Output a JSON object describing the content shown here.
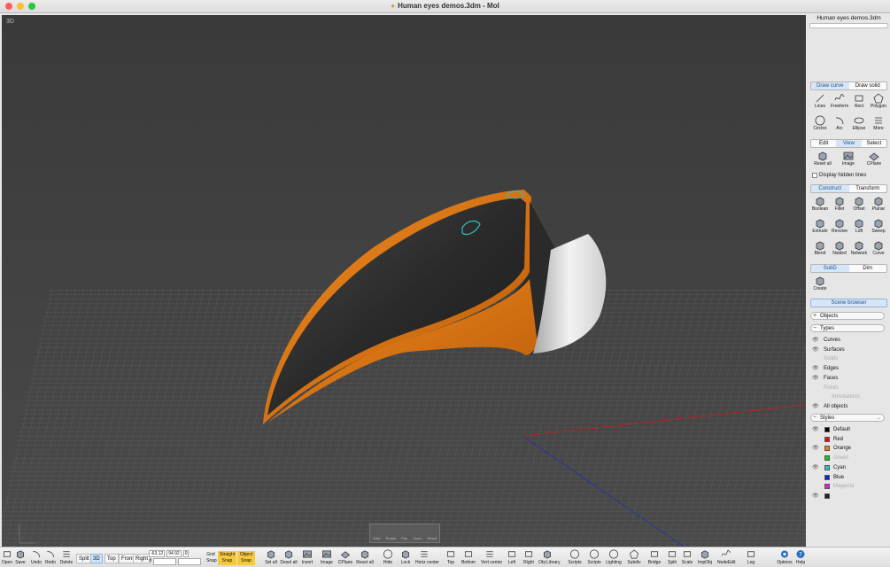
{
  "window": {
    "title": "Human eyes demos.3dm - MoI"
  },
  "viewport": {
    "label": "3D",
    "nav_labels": [
      "View",
      "Rotate",
      "Pan",
      "Zoom",
      "Reset"
    ]
  },
  "sidebar": {
    "file_name": "Human eyes demos.3dm",
    "draw_tabs": [
      "Draw curve",
      "Draw solid"
    ],
    "draw_tools": [
      "Lines",
      "Freeform",
      "Rect",
      "Polygon",
      "Circles",
      "Arc",
      "Ellipse",
      "More"
    ],
    "edit_tabs": [
      "Edit",
      "View",
      "Select"
    ],
    "view_tools": [
      "Reset all",
      "Image",
      "CPlane"
    ],
    "display_hidden_lines": "Display hidden lines",
    "construct_tabs": [
      "Construct",
      "Transform"
    ],
    "construct_tools": [
      "Boolean",
      "Fillet",
      "Offset",
      "Planar",
      "Extrude",
      "Revolve",
      "Loft",
      "Sweep",
      "Blend",
      "Nsided",
      "Network",
      "Curve"
    ],
    "subd_tabs": [
      "SubD",
      "Dim"
    ],
    "subd_tools": [
      "Create"
    ],
    "scene_browser": "Scene browser",
    "objects_label": "Objects",
    "types_label": "Types",
    "types": [
      {
        "name": "Curves",
        "visible": true
      },
      {
        "name": "Surfaces",
        "visible": true
      },
      {
        "name": "Solids",
        "visible": false
      },
      {
        "name": "Edges",
        "visible": true
      },
      {
        "name": "Faces",
        "visible": true
      },
      {
        "name": "Points",
        "visible": false
      },
      {
        "name": "Annotations",
        "visible": false
      },
      {
        "name": "All objects",
        "visible": true
      }
    ],
    "styles_label": "Styles",
    "styles": [
      {
        "name": "Default",
        "color": "#000000",
        "visible": true
      },
      {
        "name": "Red",
        "color": "#e01010",
        "visible": false
      },
      {
        "name": "Orange",
        "color": "#f07a10",
        "visible": true
      },
      {
        "name": "Green",
        "color": "#20c020",
        "visible": false
      },
      {
        "name": "Cyan",
        "color": "#20c8c8",
        "visible": true
      },
      {
        "name": "Blue",
        "color": "#1020e0",
        "visible": false
      },
      {
        "name": "Magenta",
        "color": "#e020e0",
        "visible": false
      },
      {
        "name": "",
        "color": "#222222",
        "visible": true
      }
    ]
  },
  "toolbar": {
    "left_tools": [
      "Open",
      "Save",
      "Undo",
      "Redo",
      "Delete"
    ],
    "view_buttons": [
      "Split",
      "3D",
      "Top",
      "Front",
      "Right"
    ],
    "coords": {
      "x": "-63.12",
      "y": "94.92",
      "z": "0",
      "d": "d"
    },
    "grid_snap": "Grid Snap",
    "straight_snap": "Straight Snap",
    "object_snap": "Object Snap",
    "right_tools": [
      "Sel all",
      "Desel all",
      "Invert",
      "Image",
      "CPlane",
      "Reset all",
      "Hide",
      "Lock",
      "Horiz center",
      "Top",
      "Bottom",
      "Vert center",
      "Left",
      "Right",
      "Obj Library",
      "Scripts",
      "Scripts",
      "Lighting",
      "Subdiv",
      "Bridge",
      "Split",
      "Scale",
      "ImpObj",
      "NodeEdit",
      "Log"
    ],
    "options": "Options",
    "help": "Help"
  }
}
